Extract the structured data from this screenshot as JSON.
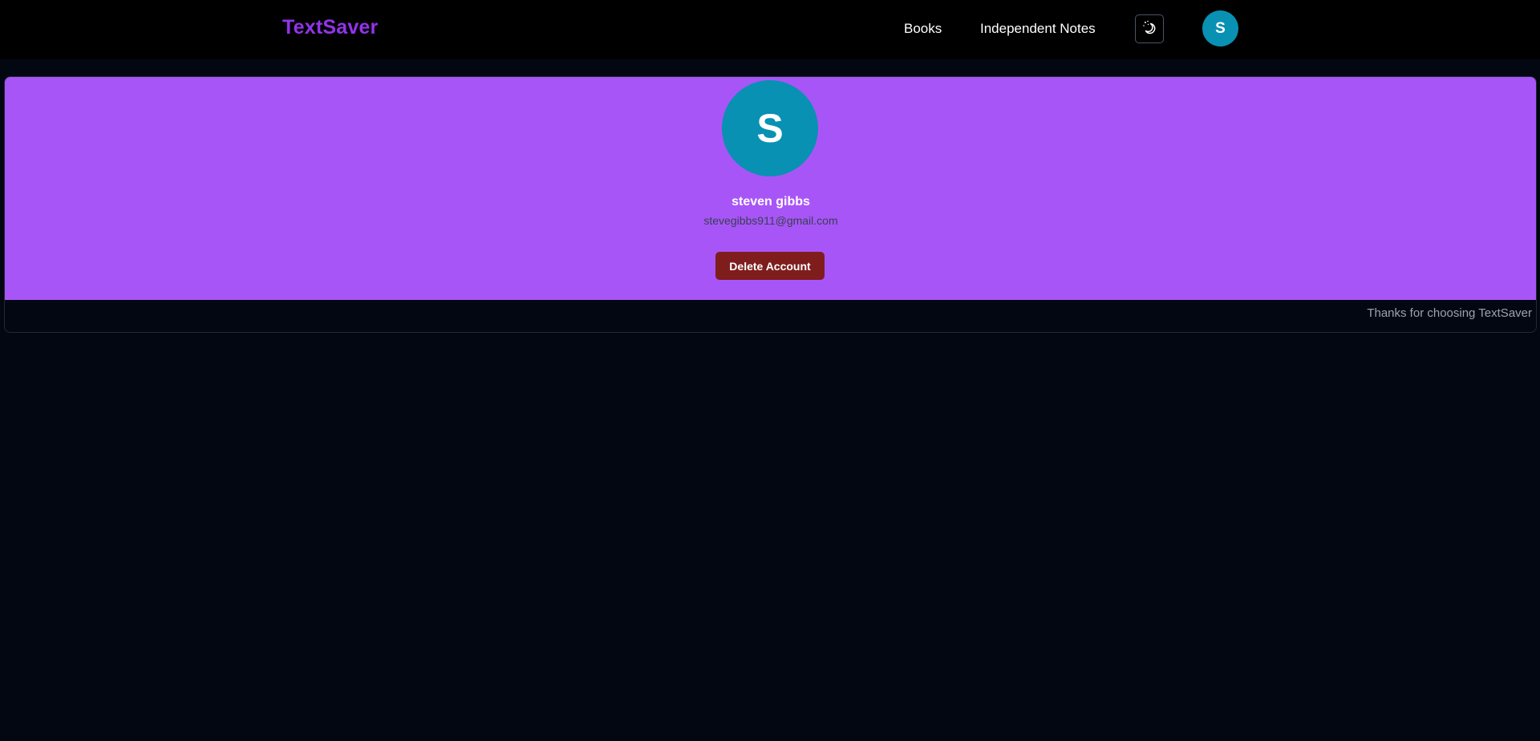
{
  "navbar": {
    "brand": "TextSaver",
    "links": [
      {
        "label": "Books"
      },
      {
        "label": "Independent Notes"
      }
    ],
    "theme_toggle_icon": "moon-stars-icon",
    "avatar_initial": "S"
  },
  "profile": {
    "avatar_initial": "S",
    "name": "steven gibbs",
    "email": "stevegibbs911@gmail.com",
    "delete_label": "Delete Account",
    "footer_note": "Thanks for choosing TextSaver"
  },
  "colors": {
    "page_background": "#030712",
    "navbar_background": "#000000",
    "brand": "#9333ea",
    "profile_banner": "#a855f7",
    "avatar": "#0891b2",
    "delete_button": "#7f1d1d"
  }
}
